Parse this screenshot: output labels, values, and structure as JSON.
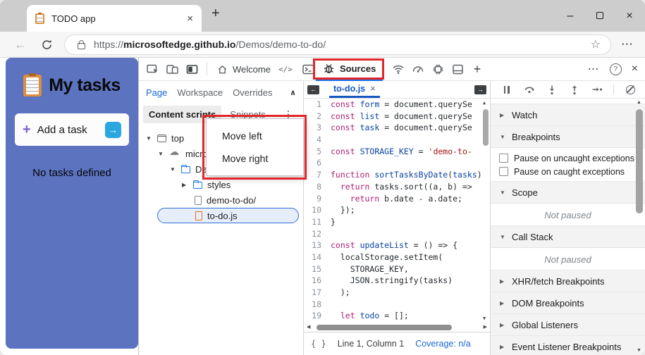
{
  "browser": {
    "tab_title": "TODO app",
    "url_scheme": "https://",
    "url_domain": "microsoftedge.github.io",
    "url_path": "/Demos/demo-to-do/"
  },
  "icons": {
    "close": "×",
    "plus": "+",
    "minimize": "–",
    "star": "☆",
    "ellipsis_h": "⋯",
    "ellipsis_v": "⋮",
    "help": "?",
    "back": "←",
    "collapse": "∧",
    "left_arrow": "←",
    "right_arrow": "→",
    "up_tri": "▲",
    "down_tri": "▼",
    "left_tri": "◀",
    "right_tri": "▶",
    "elements": "</>",
    "brace": "{ }"
  },
  "todo_app": {
    "title": "My tasks",
    "add_label": "Add a task",
    "add_plus": "+",
    "add_arrow": "→",
    "empty_text": "No tasks defined",
    "bg_color": "#5c73c0",
    "arrow_button_color": "#2aa7e0",
    "plus_color": "#7a5fd0"
  },
  "devtools": {
    "toolbar": {
      "welcome_label": "Welcome",
      "sources_label": "Sources"
    },
    "navigator": {
      "tabs": [
        "Page",
        "Workspace",
        "Overrides"
      ],
      "active_tab": "Page",
      "subtabs": [
        "Content scripts",
        "Snippets"
      ],
      "active_subtab": "Content scripts",
      "context_menu": [
        "Move left",
        "Move right"
      ],
      "tree": [
        {
          "lvl": 0,
          "caret": "▼",
          "icon": "frame",
          "label": "top"
        },
        {
          "lvl": 1,
          "caret": "▼",
          "icon": "cloud",
          "label": "microsoftedge.github.io"
        },
        {
          "lvl": 2,
          "caret": "▼",
          "icon": "folder",
          "label": "Demos"
        },
        {
          "lvl": 3,
          "caret": "▶",
          "icon": "folder",
          "label": "styles"
        },
        {
          "lvl": 3,
          "caret": "",
          "icon": "file",
          "label": "demo-to-do/"
        },
        {
          "lvl": 3,
          "caret": "",
          "icon": "filejs",
          "label": "to-do.js",
          "selected": true
        }
      ]
    },
    "editor": {
      "file_tab_label": "to-do.js",
      "lines": [
        [
          [
            "kw",
            "const"
          ],
          [
            "pl",
            " "
          ],
          [
            "df",
            "form"
          ],
          [
            "pl",
            " = document.querySe"
          ]
        ],
        [
          [
            "kw",
            "const"
          ],
          [
            "pl",
            " "
          ],
          [
            "df",
            "list"
          ],
          [
            "pl",
            " = document.querySe"
          ]
        ],
        [
          [
            "kw",
            "const"
          ],
          [
            "pl",
            " "
          ],
          [
            "df",
            "task"
          ],
          [
            "pl",
            " = document.querySe"
          ]
        ],
        [],
        [
          [
            "kw",
            "const"
          ],
          [
            "pl",
            " "
          ],
          [
            "df",
            "STORAGE_KEY"
          ],
          [
            "pl",
            " = "
          ],
          [
            "st",
            "'demo-to-"
          ]
        ],
        [],
        [
          [
            "kw",
            "function"
          ],
          [
            "pl",
            " "
          ],
          [
            "df",
            "sortTasksByDate"
          ],
          [
            "pl",
            "("
          ],
          [
            "df",
            "tasks"
          ],
          [
            "pl",
            ")"
          ]
        ],
        [
          [
            "pl",
            "  "
          ],
          [
            "kw",
            "return"
          ],
          [
            "pl",
            " tasks.sort((a, b) =>"
          ]
        ],
        [
          [
            "pl",
            "    "
          ],
          [
            "kw",
            "return"
          ],
          [
            "pl",
            " b.date - a.date;"
          ]
        ],
        [
          [
            "pl",
            "  });"
          ]
        ],
        [
          [
            "pl",
            "}"
          ]
        ],
        [],
        [
          [
            "kw",
            "const"
          ],
          [
            "pl",
            " "
          ],
          [
            "df",
            "updateList"
          ],
          [
            "pl",
            " = () => {"
          ]
        ],
        [
          [
            "pl",
            "  localStorage.setItem("
          ]
        ],
        [
          [
            "pl",
            "    STORAGE_KEY,"
          ]
        ],
        [
          [
            "pl",
            "    JSON.stringify(tasks)"
          ]
        ],
        [
          [
            "pl",
            "  );"
          ]
        ],
        [],
        [
          [
            "pl",
            "  "
          ],
          [
            "kw",
            "let"
          ],
          [
            "pl",
            " "
          ],
          [
            "df",
            "todo"
          ],
          [
            "pl",
            " = [];"
          ]
        ]
      ]
    },
    "debugger": {
      "sections": [
        {
          "type": "header",
          "caret": "▶",
          "label": "Watch"
        },
        {
          "type": "header",
          "caret": "▼",
          "label": "Breakpoints"
        },
        {
          "type": "checkboxes",
          "items": [
            "Pause on uncaught exceptions",
            "Pause on caught exceptions"
          ]
        },
        {
          "type": "header",
          "caret": "▼",
          "label": "Scope"
        },
        {
          "type": "notice",
          "text": "Not paused"
        },
        {
          "type": "header",
          "caret": "▼",
          "label": "Call Stack"
        },
        {
          "type": "notice",
          "text": "Not paused"
        },
        {
          "type": "header",
          "caret": "▶",
          "label": "XHR/fetch Breakpoints"
        },
        {
          "type": "header",
          "caret": "▶",
          "label": "DOM Breakpoints"
        },
        {
          "type": "header",
          "caret": "▶",
          "label": "Global Listeners"
        },
        {
          "type": "header",
          "caret": "▶",
          "label": "Event Listener Breakpoints"
        }
      ]
    },
    "statusbar": {
      "position": "Line 1, Column 1",
      "coverage": "Coverage: n/a"
    }
  },
  "colors": {
    "accent_blue": "#1a73e8",
    "tab_blue": "#1558c0",
    "todo_bg": "#5c73c0",
    "annotation_red": "#e3262a",
    "token_keyword": "#b01e70",
    "token_definition": "#0842a0",
    "token_string": "#a31515"
  }
}
